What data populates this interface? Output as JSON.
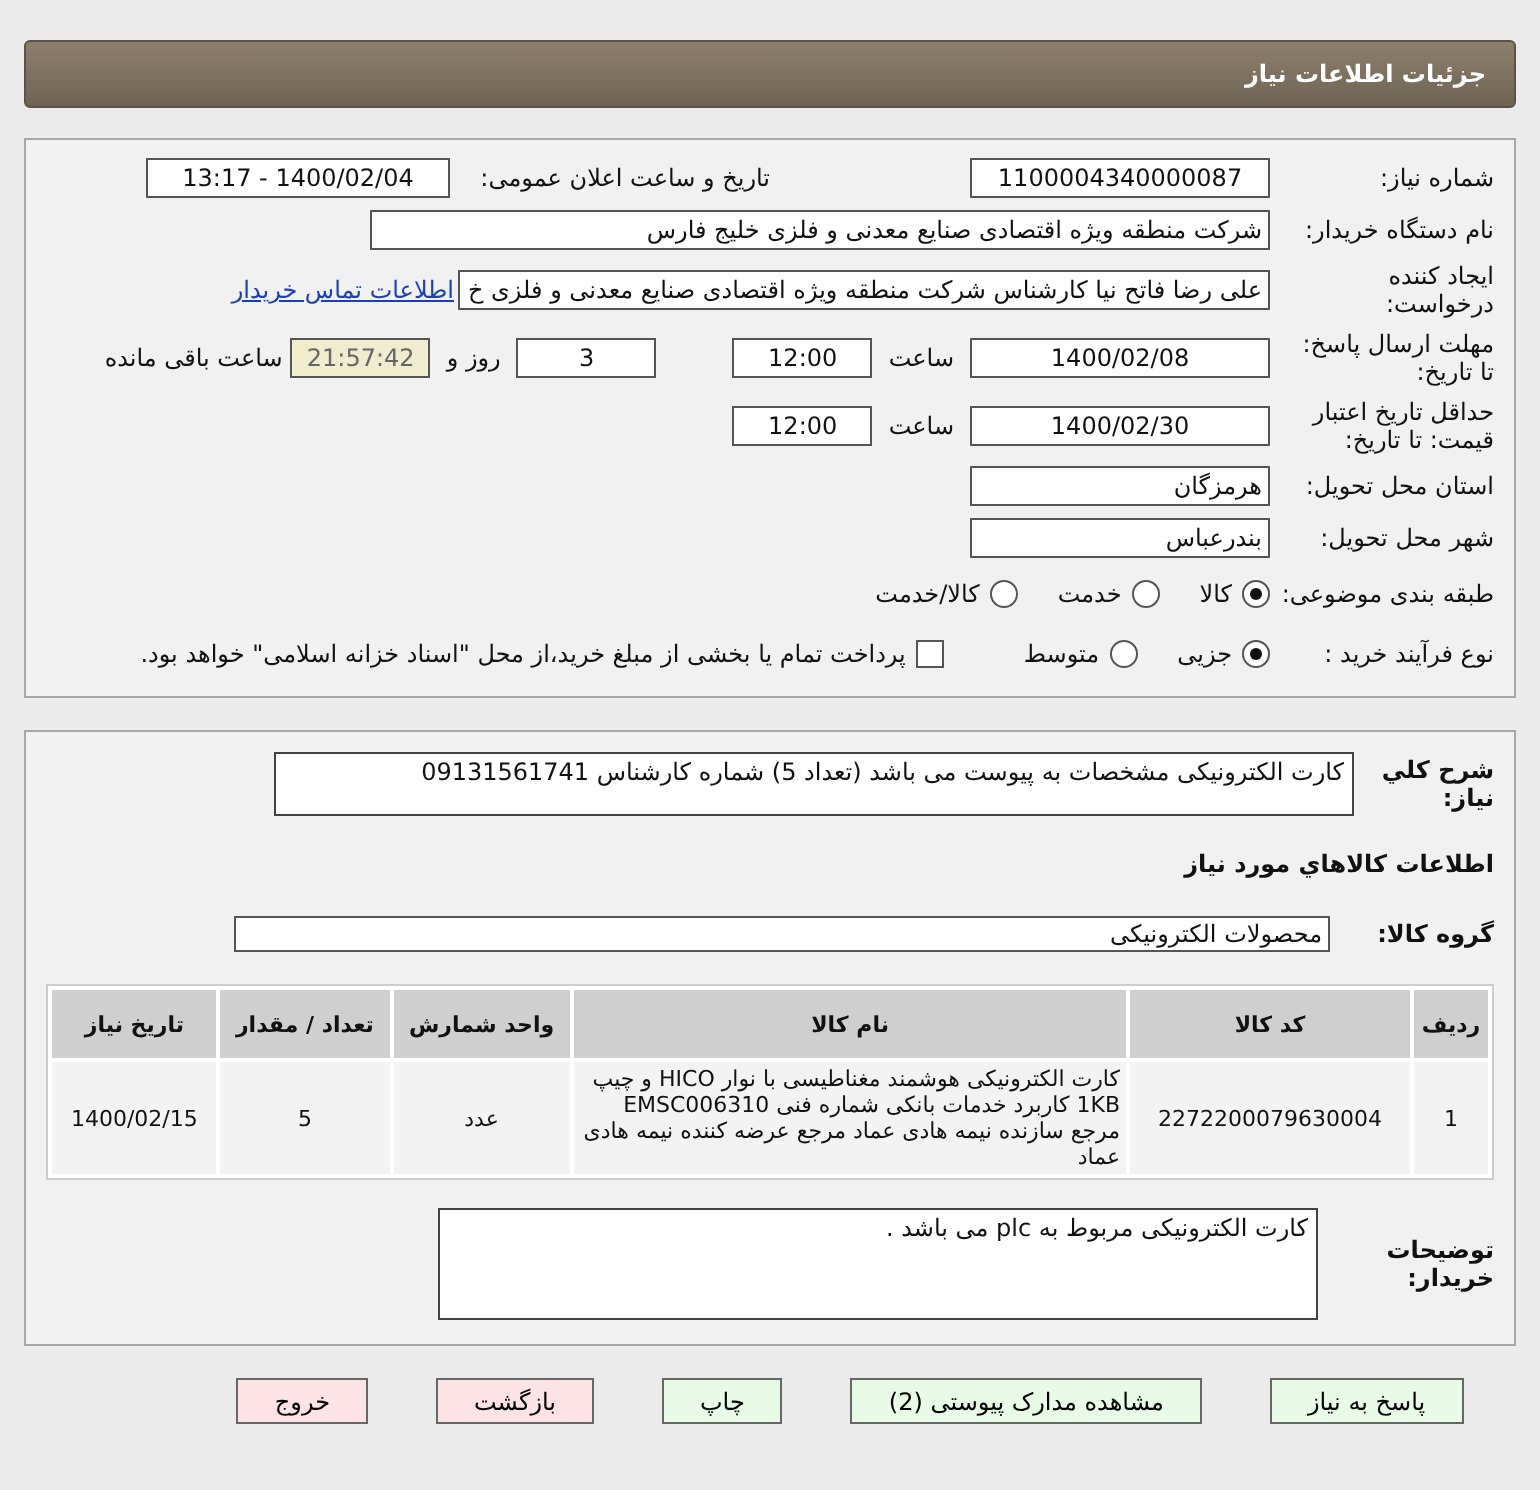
{
  "header": {
    "title": "جزئیات اطلاعات نیاز"
  },
  "details": {
    "need_number": {
      "label": "شماره نیاز:",
      "value": "1100004340000087"
    },
    "announce": {
      "label": "تاریخ و ساعت اعلان عمومی:",
      "value": "1400/02/04 - 13:17"
    },
    "buyer_org": {
      "label": "نام دستگاه خریدار:",
      "value": "شرکت منطقه ویژه اقتصادی صنایع معدنی و فلزی خلیج فارس"
    },
    "requester": {
      "label": "ایجاد کننده درخواست:",
      "value": "علی رضا فاتح نیا کارشناس  شرکت منطقه ویژه اقتصادی صنایع معدنی و فلزی خ",
      "link": "اطلاعات تماس خریدار"
    },
    "deadline": {
      "label": "مهلت ارسال پاسخ: تا تاریخ:",
      "date": "1400/02/08",
      "time_label": "ساعت",
      "time": "12:00",
      "days": "3",
      "days_label": "روز و",
      "remaining": "21:57:42",
      "remaining_label": "ساعت باقی مانده"
    },
    "validity": {
      "label": "حداقل تاریخ اعتبار قیمت: تا تاریخ:",
      "date": "1400/02/30",
      "time_label": "ساعت",
      "time": "12:00"
    },
    "province": {
      "label": "استان محل تحویل:",
      "value": "هرمزگان"
    },
    "city": {
      "label": "شهر محل تحویل:",
      "value": "بندرعباس"
    },
    "category": {
      "label": "طبقه بندی موضوعی:",
      "options": [
        {
          "label": "کالا",
          "selected": true
        },
        {
          "label": "خدمت",
          "selected": false
        },
        {
          "label": "کالا/خدمت",
          "selected": false
        }
      ]
    },
    "process": {
      "label": "نوع فرآیند خرید :",
      "options": [
        {
          "label": "جزیی",
          "selected": true
        },
        {
          "label": "متوسط",
          "selected": false
        }
      ],
      "payment": {
        "checked": false,
        "label": "پرداخت تمام یا بخشی از مبلغ خرید،از محل \"اسناد خزانه اسلامی\" خواهد بود."
      }
    }
  },
  "goods": {
    "description": {
      "label": "شرح كلي نياز:",
      "value": "کارت الکترونیکی مشخصات به پیوست می باشد (تعداد 5) شماره کارشناس 09131561741"
    },
    "section_title": "اطلاعات كالاهاي مورد نياز",
    "group": {
      "label": "گروه كالا:",
      "value": "محصولات الکترونیکی"
    },
    "table": {
      "columns": [
        "ردیف",
        "کد کالا",
        "نام کالا",
        "واحد شمارش",
        "تعداد / مقدار",
        "تاریخ نیاز"
      ],
      "rows": [
        [
          "1",
          "2272200079630004",
          "کارت الکترونیکی هوشمند مغناطیسی با نوار HICO و چیپ 1KB کاربرد خدمات بانکی شماره فنی EMSC006310 مرجع سازنده نیمه هادی عماد مرجع عرضه کننده نیمه هادی عماد",
          "عدد",
          "5",
          "1400/02/15"
        ]
      ]
    },
    "notes": {
      "label": "توضیحات خریدار:",
      "value": "کارت الکترونیکی مربوط به  plc می باشد ."
    }
  },
  "buttons": [
    {
      "label": "پاسخ به نیاز",
      "kind": "normal"
    },
    {
      "label": "مشاهده مدارک پیوستی (2)",
      "kind": "normal"
    },
    {
      "label": "چاپ",
      "kind": "normal"
    },
    {
      "label": "بازگشت",
      "kind": "danger"
    },
    {
      "label": "خروج",
      "kind": "danger"
    }
  ]
}
